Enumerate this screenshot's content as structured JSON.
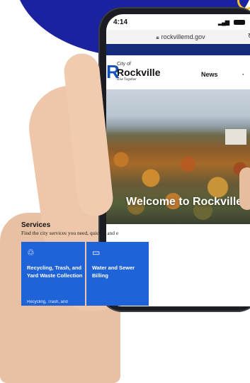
{
  "status_bar": {
    "time": "4:14",
    "signal_icon": "signal-wifi-icon",
    "battery_icon": "battery-icon"
  },
  "browser": {
    "url": "rockvillemd.gov",
    "lock_icon": "lock-icon",
    "reload_icon": "reload-icon"
  },
  "site": {
    "logo": {
      "city": "City of",
      "name": "Rockville",
      "tagline": "Rise Together"
    },
    "nav": {
      "news": "News"
    },
    "hero": {
      "title": "Welcome to Rockville"
    },
    "services": {
      "title": "Services",
      "subtitle": "Find the city services you need, quickly and e",
      "cards": [
        {
          "icon": "recycle-icon",
          "label": "Recycling, Trash, and Yard Waste Collection",
          "desc": "Recycling, Trash, and"
        },
        {
          "icon": "billing-icon",
          "label": "Water and Sewer Billing"
        }
      ]
    }
  },
  "colors": {
    "brand_blue": "#1f63d8",
    "header_strip": "#142a7a",
    "background_blob": "#1a22a0"
  }
}
